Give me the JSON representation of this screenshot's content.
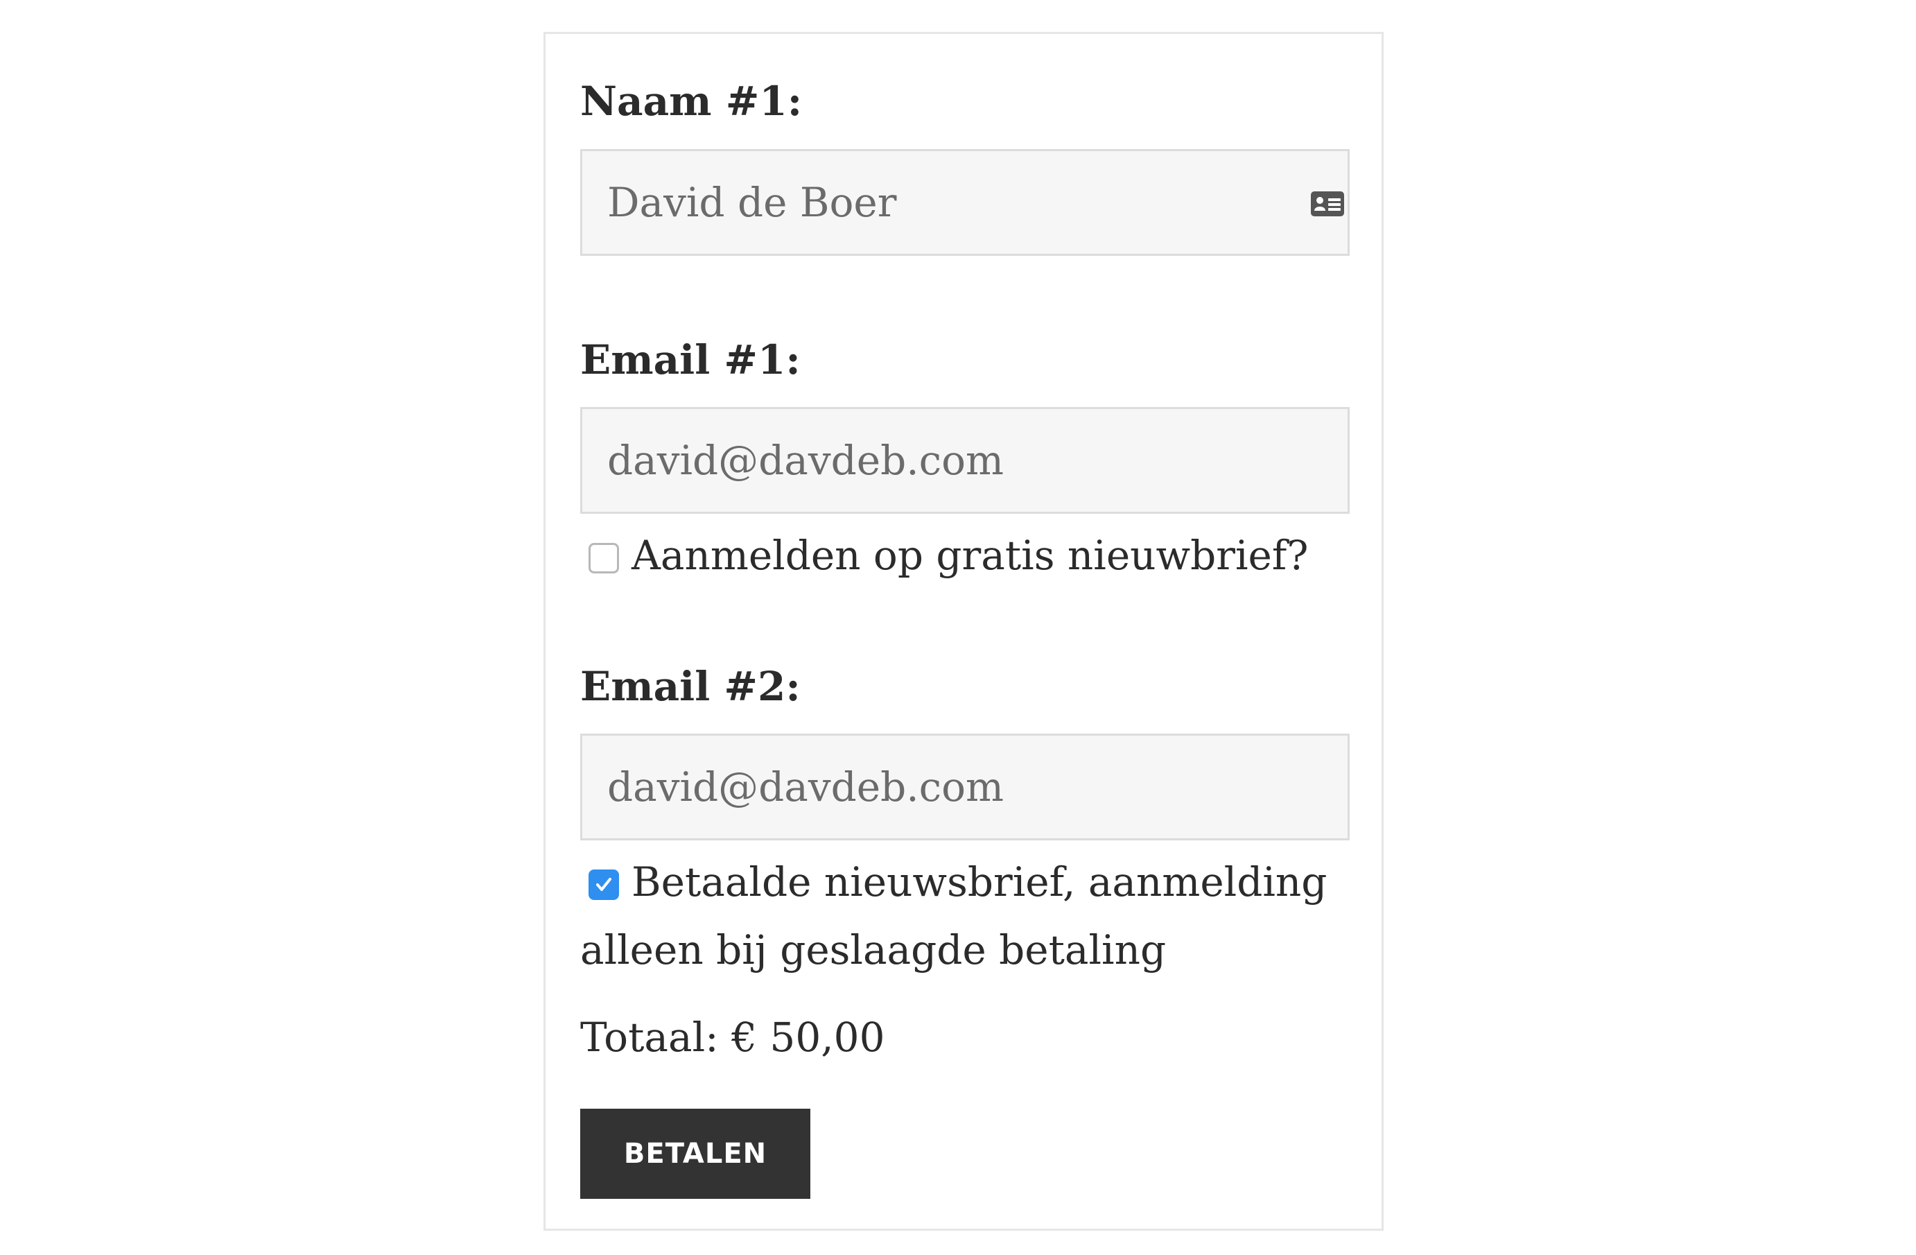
{
  "form": {
    "name_label": "Naam #1:",
    "name_value": "David de Boer",
    "name_icon": "contact-card-icon",
    "email1_label": "Email #1:",
    "email1_value": "david@davdeb.com",
    "newsletter_free_label": "Aanmelden op gratis nieuwbrief?",
    "newsletter_free_checked": false,
    "email2_label": "Email #2:",
    "email2_value": "david@davdeb.com",
    "newsletter_paid_label": "Betaalde nieuwsbrief, aanmelding alleen bij geslaagde betaling",
    "newsletter_paid_checked": true,
    "total_text": "Totaal: € 50,00",
    "pay_button_label": "BETALEN"
  },
  "colors": {
    "checkbox_checked": "#2f8ff0",
    "button_background": "#333333",
    "input_background": "#f6f6f6"
  }
}
